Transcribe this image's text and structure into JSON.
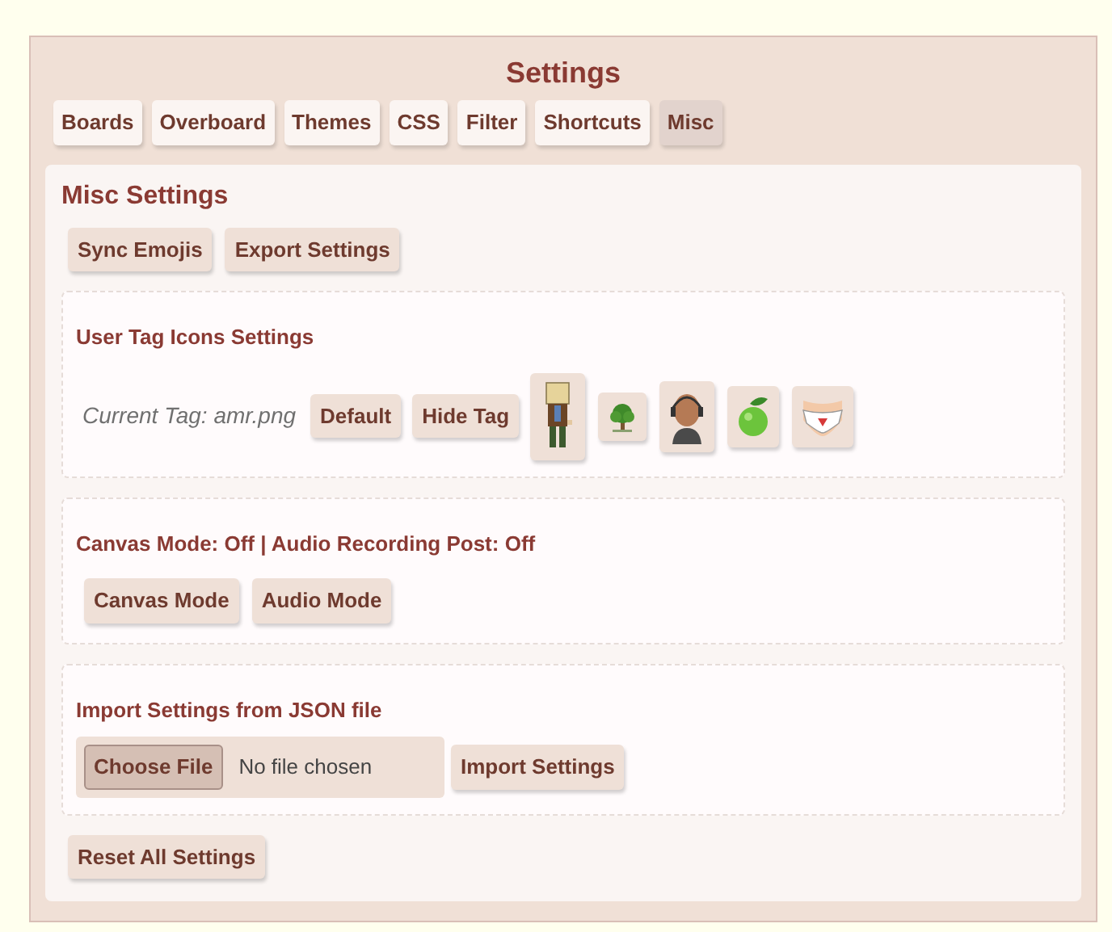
{
  "title": "Settings",
  "tabs": [
    {
      "label": "Boards",
      "selected": false
    },
    {
      "label": "Overboard",
      "selected": false
    },
    {
      "label": "Themes",
      "selected": false
    },
    {
      "label": "CSS",
      "selected": false
    },
    {
      "label": "Filter",
      "selected": false
    },
    {
      "label": "Shortcuts",
      "selected": false
    },
    {
      "label": "Misc",
      "selected": true
    }
  ],
  "heading": "Misc Settings",
  "top_buttons": [
    "Sync Emojis",
    "Export Settings"
  ],
  "tag_section": {
    "title": "User Tag Icons Settings",
    "current_tag": "Current Tag: amr.png",
    "buttons": [
      "Default",
      "Hide Tag"
    ],
    "icons": [
      {
        "kind": "boxhead"
      },
      {
        "kind": "tree"
      },
      {
        "kind": "person"
      },
      {
        "kind": "lime"
      },
      {
        "kind": "garment"
      }
    ]
  },
  "mode_section": {
    "status": "Canvas Mode: Off | Audio Recording Post: Off",
    "buttons": [
      "Canvas Mode",
      "Audio Mode"
    ]
  },
  "import_section": {
    "title": "Import Settings from JSON file",
    "choose_button": "Choose File",
    "file_status": "No file chosen",
    "import_button": "Import Settings"
  },
  "reset_button": "Reset All Settings"
}
